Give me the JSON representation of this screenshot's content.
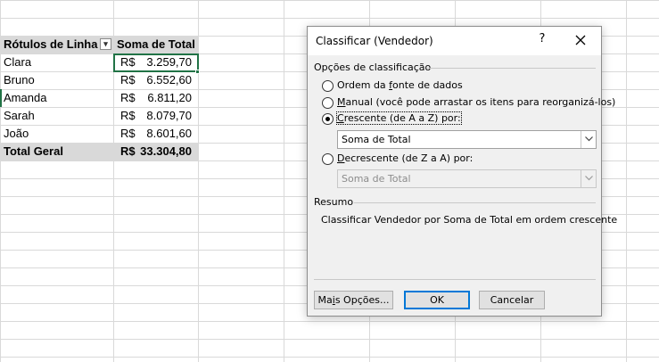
{
  "pivot": {
    "header": {
      "row_labels": "Rótulos de Linha",
      "sum_total": "Soma de Total"
    },
    "rows": [
      {
        "name": "Clara",
        "currency": "R$",
        "amount": "3.259,70"
      },
      {
        "name": "Bruno",
        "currency": "R$",
        "amount": "6.552,60"
      },
      {
        "name": "Amanda",
        "currency": "R$",
        "amount": "6.811,20"
      },
      {
        "name": "Sarah",
        "currency": "R$",
        "amount": "8.079,70"
      },
      {
        "name": "João",
        "currency": "R$",
        "amount": "8.601,60"
      }
    ],
    "total": {
      "label": "Total Geral",
      "currency": "R$",
      "amount": "33.304,80"
    },
    "filter_icon": "filter-sort-icon"
  },
  "dialog": {
    "title": "Classificar (Vendedor)",
    "help": "?",
    "close_icon": "close-icon",
    "options_section": "Opções de classificação",
    "option_data_source": {
      "pre": "Ordem da ",
      "ul": "f",
      "post": "onte de dados"
    },
    "option_manual": {
      "ul": "M",
      "post": "anual (você pode arrastar os itens para reorganizá-los)"
    },
    "option_ascending": {
      "ul": "C",
      "post": "rescente (de A a Z) por:",
      "selected": true
    },
    "ascending_field": "Soma de Total",
    "option_descending": {
      "ul": "D",
      "post": "ecrescente (de Z a A) por:"
    },
    "descending_field": "Soma de Total",
    "summary_section": "Resumo",
    "summary_text": "Classificar Vendedor por Soma de Total em ordem crescente",
    "more_options": {
      "pre": "Ma",
      "ul": "i",
      "post": "s Opções..."
    },
    "ok_label": "OK",
    "cancel_label": "Cancelar"
  },
  "colors": {
    "accent": "#217346",
    "pivot_header_bg": "#d9d9d9",
    "default_button_border": "#0078d7"
  }
}
